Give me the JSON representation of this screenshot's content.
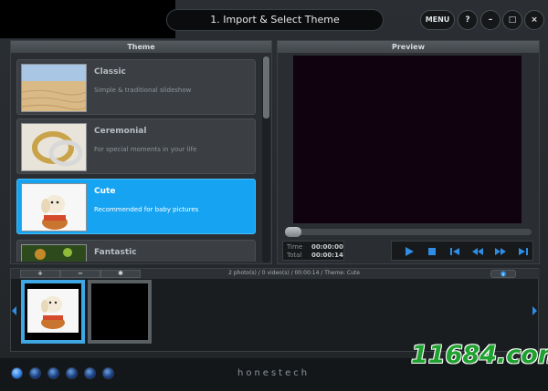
{
  "window": {
    "title": "1. Import & Select Theme",
    "menu_label": "MENU",
    "help_label": "?",
    "minimize_label": "–",
    "maximize_label": "□",
    "close_label": "×"
  },
  "theme_panel": {
    "header": "Theme",
    "items": [
      {
        "title": "Classic",
        "desc": "Simple & traditional slideshow",
        "selected": false
      },
      {
        "title": "Ceremonial",
        "desc": "For special moments in your life",
        "selected": false
      },
      {
        "title": "Cute",
        "desc": "Recommended for baby pictures",
        "selected": true
      },
      {
        "title": "Fantastic",
        "desc": "",
        "selected": false
      }
    ]
  },
  "preview_panel": {
    "header": "Preview",
    "time_label": "Time",
    "time_value": "00:00:00",
    "total_label": "Total",
    "total_value": "00:00:14",
    "progress": 0
  },
  "storyboard": {
    "add_label": "+",
    "remove_label": "−",
    "effect_label": "✱",
    "info": "2 photo(s) / 0 video(s) / 00:00:14 / Theme: Cute"
  },
  "footer": {
    "brand": "honestech",
    "step_count": 6,
    "active_step": 1
  },
  "watermark": "11684.com",
  "colors": {
    "accent": "#16a4f2",
    "control_blue": "#2f8de4",
    "watermark_green": "#1fa12f"
  }
}
